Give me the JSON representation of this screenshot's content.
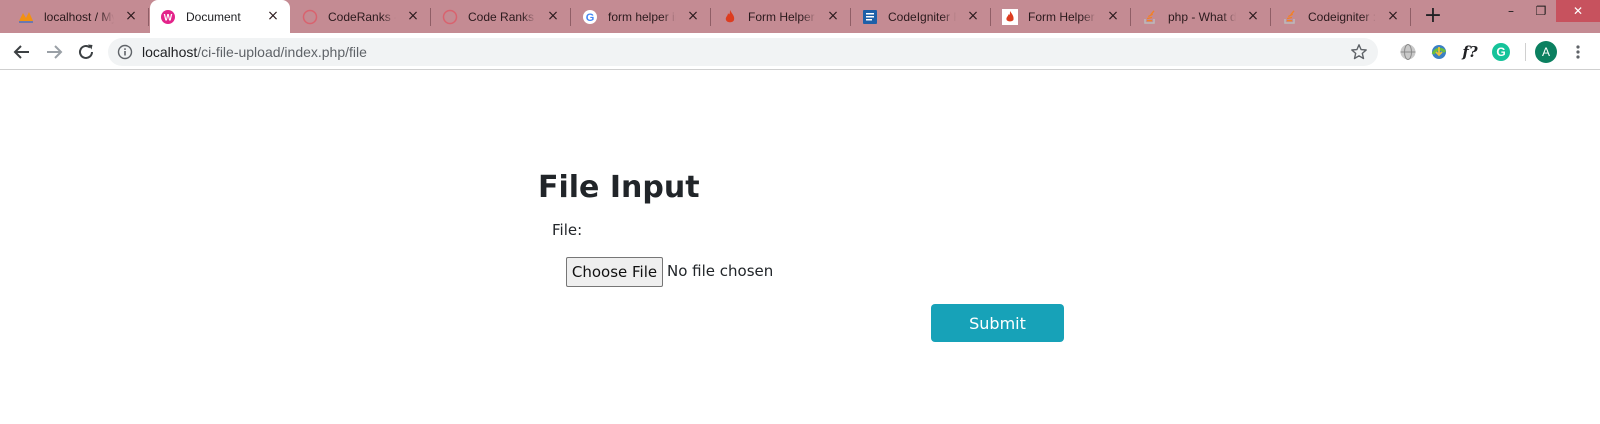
{
  "browser": {
    "tabs": [
      {
        "title": "localhost / My",
        "icon": "phpmyadmin-icon",
        "active": false
      },
      {
        "title": "Document",
        "icon": "page-icon",
        "active": true
      },
      {
        "title": "CodeRanks - A",
        "icon": "coderanks-icon",
        "active": false
      },
      {
        "title": "Code Ranks | N",
        "icon": "coderanks-icon",
        "active": false
      },
      {
        "title": "form helper in",
        "icon": "google-icon",
        "active": false
      },
      {
        "title": "Form Helper :",
        "icon": "flame-icon",
        "active": false
      },
      {
        "title": "CodeIgniter Fo",
        "icon": "doc-icon",
        "active": false
      },
      {
        "title": "Form Helper —",
        "icon": "flame-icon",
        "active": false
      },
      {
        "title": "php - What do",
        "icon": "stackoverflow-icon",
        "active": false
      },
      {
        "title": "Codeigniter : C",
        "icon": "stackoverflow-icon",
        "active": false
      }
    ],
    "close_glyph": "×",
    "new_tab_glyph": "+",
    "window_controls": {
      "minimize": "–",
      "restore": "❐",
      "close": "✕"
    },
    "url_host": "localhost",
    "url_path": "/ci-file-upload/index.php/file",
    "profile_initial": "A",
    "extension_formula": "f?",
    "extension_grammarly": "G"
  },
  "page": {
    "heading": "File Input",
    "file_label": "File:",
    "choose_file_label": "Choose File",
    "no_file_text": "No file chosen",
    "submit_label": "Submit"
  },
  "colors": {
    "tab_strip": "#c48b93",
    "submit_button": "#17a2b8",
    "avatar": "#0b8060"
  }
}
